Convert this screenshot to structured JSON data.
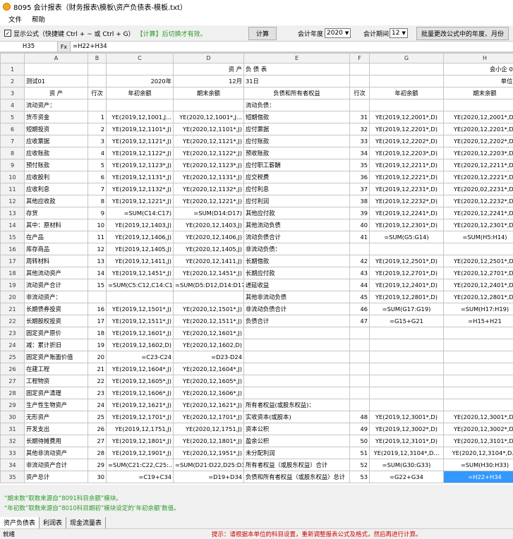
{
  "window": {
    "title": "8095 会计报表（财务报表\\模板\\资产负债表-模板.txt）"
  },
  "menu": [
    "文件",
    "帮助"
  ],
  "toolbar": {
    "show_formula_label": "显示公式（快捷键 Ctrl + ~ 或 Ctrl + G）",
    "show_formula_hint": "【计算】后切换才有效。",
    "calc_button": "计算",
    "year_label": "会计年度",
    "year_value": "2020",
    "period_label": "会计期间",
    "period_value": "12",
    "batch_button": "批量更改公式中的年度、月份"
  },
  "formula_bar": {
    "cell_ref": "H35",
    "fx_label": "Fx",
    "formula": "=H22+H34"
  },
  "columns": [
    "",
    "A",
    "B",
    "C",
    "D",
    "E",
    "F",
    "G",
    "H"
  ],
  "rows": [
    [
      "1",
      "",
      "",
      "",
      "资 产",
      "负 债 表",
      "",
      "",
      "会小企 01 表"
    ],
    [
      "2",
      "测试01",
      "",
      "2020年",
      "12月",
      "31日",
      "",
      "",
      "单位：元"
    ],
    [
      "3",
      "资    产",
      "行次",
      "年初余额",
      "期末余额",
      "负债和所有者权益",
      "行次",
      "年初余额",
      "期末余额"
    ],
    [
      "4",
      "流动资产：",
      "",
      "",
      "",
      "流动负债：",
      "",
      "",
      ""
    ],
    [
      "5",
      "  货币资金",
      "1",
      "YE(2019,12,1001,J...",
      "YE(2020,12,1001*,J...",
      "  短期借款",
      "31",
      "YE(2019,12,2001*,D)",
      "YE(2020,12,2001*,D)"
    ],
    [
      "6",
      "  短期投资",
      "2",
      "YE(2019,12,1101*,J)",
      "YE(2020,12,1101*,J)",
      "  应付票据",
      "32",
      "YE(2019,12,2201*,D)",
      "YE(2020,12,2201*,D)"
    ],
    [
      "7",
      "  应收票据",
      "3",
      "YE(2019,12,1121*,J)",
      "YE(2020,12,1121*,J)",
      "  应付账款",
      "33",
      "YE(2019,12,2202*,D)",
      "YE(2020,12,2202*,D)"
    ],
    [
      "8",
      "  应收账款",
      "4",
      "YE(2019,12,1122*,J)",
      "YE(2020,12,1122*,J)",
      "  预收账款",
      "34",
      "YE(2019,12,2203*,D)",
      "YE(2020,12,2203*,D)"
    ],
    [
      "9",
      "  预付账款",
      "5",
      "YE(2019,12,1123*,J)",
      "YE(2020,12,1123*,J)",
      "  应付职工薪酬",
      "35",
      "YE(2019,12,2211*,D)",
      "YE(2020,12,2211*,D)"
    ],
    [
      "10",
      "  应收股利",
      "6",
      "YE(2019,12,1131*,J)",
      "YE(2020,12,1131*,J)",
      "  应交税费",
      "36",
      "YE(2019,12,2221*,D)",
      "YE(2020,12,2221*,D)"
    ],
    [
      "11",
      "  应收利息",
      "7",
      "YE(2019,12,1132*,J)",
      "YE(2020,12,1132*,J)",
      "  应付利息",
      "37",
      "YE(2019,12,2231*,D)",
      "YE(2020,02,2231*,D)"
    ],
    [
      "12",
      "  其他应收款",
      "8",
      "YE(2019,12,1221*,J)",
      "YE(2020,12,1221*,J)",
      "  应付利润",
      "38",
      "YE(2019,12,2232*,D)",
      "YE(2020,12,2232*,D)"
    ],
    [
      "13",
      "  存货",
      "9",
      "=SUM(C14:C17)",
      "=SUM(D14:D17)",
      "  其他应付款",
      "39",
      "YE(2019,12,2241*,D)",
      "YE(2020,12,2241*,D)"
    ],
    [
      "14",
      "    其中：原材料",
      "10",
      "YE(2019,12,1403,J)",
      "YE(2020,12,1403,J)",
      "  其他流动负债",
      "40",
      "YE(2019,12,2301*,D)",
      "YE(2020,12,2301*,D)"
    ],
    [
      "15",
      "          在产品",
      "11",
      "YE(2019,12,1406,J)",
      "YE(2020,12,1406,J)",
      "流动负债合计",
      "41",
      "=SUM(G5:G14)",
      "=SUM(H5:H14)"
    ],
    [
      "16",
      "          库存商品",
      "12",
      "YE(2019,12,1405,J)",
      "YE(2020,12,1405,J)",
      "非流动负债：",
      "",
      "",
      ""
    ],
    [
      "17",
      "          周转材料",
      "13",
      "YE(2019,12,1411,J)",
      "YE(2020,12,1411,J)",
      "  长期借款",
      "42",
      "YE(2019,12,2501*,D)",
      "YE(2020,12,2501*,D)"
    ],
    [
      "18",
      "  其他流动资产",
      "14",
      "YE(2019,12,1451*,J)",
      "YE(2020,12,1451*,J)",
      "  长期应付款",
      "43",
      "YE(2019,12,2701*,D)",
      "YE(2020,12,2701*,D)"
    ],
    [
      "19",
      "流动资产合计",
      "15",
      "=SUM(C5:C12,C14:C18)",
      "=SUM(D5:D12,D14:D17)",
      "  递延收益",
      "44",
      "YE(2019,12,2401*,D)",
      "YE(2020,12,2401*,D)"
    ],
    [
      "20",
      "非流动资产：",
      "",
      "",
      "",
      "  其他非流动负债",
      "45",
      "YE(2019,12,2801*,D)",
      "YE(2020,12,2801*,D)"
    ],
    [
      "21",
      "  长期债券投资",
      "16",
      "YE(2019,12,1501*,J)",
      "YE(2020,12,1501*,J)",
      "非流动负债合计",
      "46",
      "=SUM(G17:G19)",
      "=SUM(H17:H19)"
    ],
    [
      "22",
      "  长期股权投资",
      "17",
      "YE(2019,12,1511*,J)",
      "YE(2020,12,1511*,J)",
      "负债合计",
      "47",
      "=G15+G21",
      "=H15+H21"
    ],
    [
      "23",
      "  固定资产原价",
      "18",
      "YE(2019,12,1601*,J)",
      "YE(2020,12,1601*,J)",
      "",
      "",
      "",
      ""
    ],
    [
      "24",
      "  减：累计折旧",
      "19",
      "YE(2019,12,1602,D)",
      "YE(2020,12,1602,D)",
      "",
      "",
      "",
      ""
    ],
    [
      "25",
      "  固定资产账面价值",
      "20",
      "=C23-C24",
      "=D23-D24",
      "",
      "",
      "",
      ""
    ],
    [
      "26",
      "  在建工程",
      "21",
      "YE(2019,12,1604*,J)",
      "YE(2020,12,1604*,J)",
      "",
      "",
      "",
      ""
    ],
    [
      "27",
      "  工程物资",
      "22",
      "YE(2019,12,1605*,J)",
      "YE(2020,12,1605*,J)",
      "",
      "",
      "",
      ""
    ],
    [
      "28",
      "  固定资产清理",
      "23",
      "YE(2019,12,1606*,J)",
      "YE(2020,12,1606*,J)",
      "",
      "",
      "",
      ""
    ],
    [
      "29",
      "  生产性生物资产",
      "24",
      "YE(2019,12,1621*,J)",
      "YE(2020,12,1621*,J)",
      "所有者权益(或股东权益)：",
      "",
      "",
      ""
    ],
    [
      "30",
      "  无形资产",
      "25",
      "YE(2019,12,1701*,J)",
      "YE(2020,12,1701*,J)",
      "  实收资本(或股本)",
      "48",
      "YE(2019,12,3001*,D)",
      "YE(2020,12,3001*,D)"
    ],
    [
      "31",
      "  开发支出",
      "26",
      "YE(2019,12,1751,J)",
      "YE(2020,12,1751,J)",
      "  资本公积",
      "49",
      "YE(2019,12,3002*,D)",
      "YE(2020,12,3002*,D)"
    ],
    [
      "32",
      "  长期待摊费用",
      "27",
      "YE(2019,12,1801*,J)",
      "YE(2020,12,1801*,J)",
      "  盈余公积",
      "50",
      "YE(2019,12,3101*,D)",
      "YE(2020,12,3101*,D)"
    ],
    [
      "33",
      "  其他非流动资产",
      "28",
      "YE(2019,12,1901*,J)",
      "YE(2020,12,1951*,J)",
      "  未分配利润",
      "51",
      "YE(2019,12,3104*,D...",
      "YE(2020,12,3104*,D..."
    ],
    [
      "34",
      "非流动资产合计",
      "29",
      "=SUM(C21:C22,C25:...",
      "=SUM(D21:D22,D25:D33)",
      "所有者权益（或股东权益）合计",
      "52",
      "=SUM(G30:G33)",
      "=SUM(H30:H33)"
    ],
    [
      "35",
      "资产总计",
      "30",
      "=C19+C34",
      "=D19+D34",
      "负债和所有者权益（或股东权益）总计",
      "53",
      "=G22+G34",
      "=H22+H34"
    ]
  ],
  "notes": [
    "“期末数”取数来源自“8091科目余额”模块。",
    "“年初数”取数来源自“8010科目期初”模块设定的‘年初余额’数值。"
  ],
  "sheet_tabs": [
    "资产负债表",
    "利润表",
    "现金流量表"
  ],
  "status": {
    "left": "就绪",
    "tip": "提示：请根据本单位的科目设置，重新调整报表公式及格式，然后再进行计算。"
  }
}
